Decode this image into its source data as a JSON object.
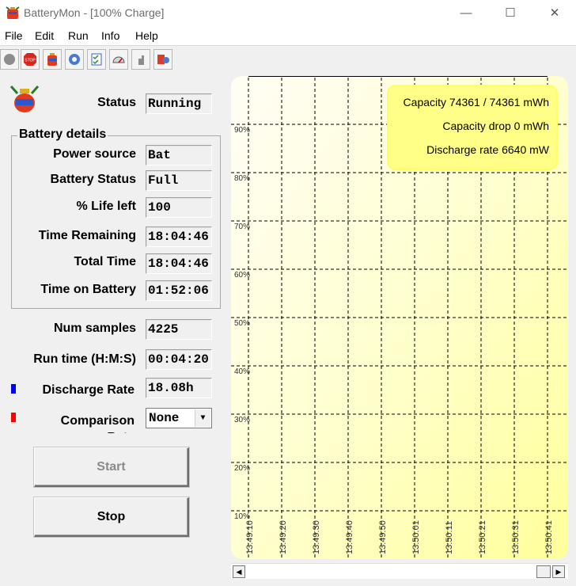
{
  "window": {
    "title": "BatteryMon - [100% Charge]",
    "controls": {
      "minimize": "—",
      "maximize": "☐",
      "close": "✕"
    }
  },
  "menu": {
    "items": [
      "File",
      "Edit",
      "Run",
      "Info",
      "Help"
    ]
  },
  "toolbar": {
    "buttons": [
      "record-icon",
      "stop-icon",
      "battery-icon",
      "settings-icon",
      "checklist-icon",
      "gauge-icon",
      "help-pointer-icon",
      "info-icon"
    ]
  },
  "status": {
    "label": "Status",
    "value": "Running"
  },
  "battery_details": {
    "title": "Battery details",
    "power_source": {
      "label": "Power source",
      "value": "Bat"
    },
    "battery_status": {
      "label": "Battery Status",
      "value": "Full"
    },
    "life_left": {
      "label": "% Life left",
      "value": "100"
    },
    "time_remaining": {
      "label": "Time Remaining",
      "value": "18:04:46"
    },
    "total_time": {
      "label": "Total Time",
      "value": "18:04:46"
    },
    "time_on_battery": {
      "label": "Time on Battery",
      "value": "01:52:06"
    }
  },
  "samples": {
    "label": "Num samples",
    "value": "4225"
  },
  "run_time": {
    "label": "Run time (H:M:S)",
    "value": "00:04:20"
  },
  "discharge_rate": {
    "label": "Discharge Rate",
    "value": "18.08h",
    "marker_color": "#0000ff"
  },
  "comparison": {
    "label": "Comparison Rate",
    "selected": "None",
    "marker_color": "#ff0000"
  },
  "buttons": {
    "start": "Start",
    "stop": "Stop"
  },
  "chart_data": {
    "type": "line",
    "y_tick_labels": [
      "90%",
      "80%",
      "70%",
      "60%",
      "50%",
      "40%",
      "30%",
      "20%",
      "10%"
    ],
    "x_tick_labels": [
      "13:49:10",
      "13:49:20",
      "13:49:30",
      "13:49:40",
      "13:49:50",
      "13:50:01",
      "13:50:11",
      "13:50:21",
      "13:50:31",
      "13:50:41"
    ],
    "ylim": [
      10,
      100
    ],
    "grid": true,
    "series": [
      {
        "name": "Discharge Rate",
        "color": "#0000ff",
        "values": [
          100,
          100,
          100,
          100,
          100,
          100,
          100,
          100,
          100,
          100
        ]
      }
    ],
    "info_box": {
      "capacity": "Capacity 74361 / 74361 mWh",
      "capacity_drop": "Capacity drop 0 mWh",
      "discharge_rate": "Discharge rate 6640 mW"
    },
    "background_color": "#ffff9a"
  }
}
